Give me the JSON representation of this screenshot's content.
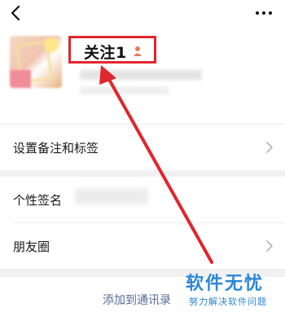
{
  "header": {
    "back_icon": "chevron-left-icon",
    "more_icon": "ellipsis-icon"
  },
  "profile": {
    "name": "关注1",
    "gender_icon": "person-icon",
    "highlight_color": "#e0262e"
  },
  "rows": [
    {
      "label": "设置备注和标签",
      "has_chevron": true
    },
    {
      "label": "个性签名",
      "has_chevron": false
    },
    {
      "label": "朋友圈",
      "has_chevron": true
    }
  ],
  "actions": {
    "add_contact": "添加到通讯录"
  },
  "watermark": {
    "title": "软件无忧",
    "subtitle": "努力解决软件问题"
  }
}
